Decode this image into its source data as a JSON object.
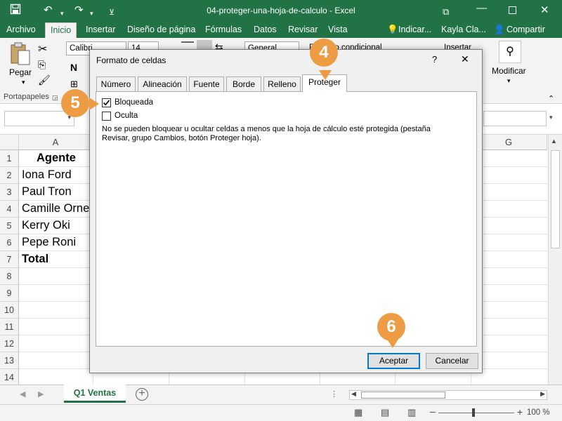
{
  "window": {
    "title": "04-proteger-una-hoja-de-calculo  -  Excel"
  },
  "menu": {
    "tabs": [
      "Archivo",
      "Inicio",
      "Insertar",
      "Diseño de página",
      "Fórmulas",
      "Datos",
      "Revisar",
      "Vista"
    ],
    "tell_me": "Indicar...",
    "user": "Kayla Cla...",
    "share": "Compartir"
  },
  "ribbon": {
    "paste_label": "Pegar",
    "clipboard_group": "Portapapeles",
    "font_name": "Calibri",
    "font_size": "14",
    "number_format": "General",
    "conditional_format": "Formato condicional",
    "insert_label": "Insertar",
    "modify_label": "Modificar"
  },
  "sheet": {
    "columns": [
      "A",
      "G"
    ],
    "rows": [
      "1",
      "2",
      "3",
      "4",
      "5",
      "6",
      "7",
      "8",
      "9",
      "10",
      "11",
      "12",
      "13",
      "14"
    ],
    "cells": [
      "Agente",
      "Iona Ford",
      "Paul Tron",
      "Camille  Orne",
      "Kerry Oki",
      "Pepe Roni",
      "Total"
    ],
    "active_tab": "Q1 Ventas",
    "zoom": "100 %"
  },
  "dialog": {
    "title": "Formato de celdas",
    "help": "?",
    "close": "✕",
    "tabs": [
      "Número",
      "Alineación",
      "Fuente",
      "Borde",
      "Relleno",
      "Proteger"
    ],
    "locked_label": "Bloqueada",
    "locked_checked": true,
    "hidden_label": "Oculta",
    "hidden_checked": false,
    "note": "No se pueden bloquear u ocultar celdas a menos que la hoja de cálculo esté protegida (pestaña Revisar, grupo Cambios, botón Proteger hoja).",
    "ok_button": "Aceptar",
    "cancel_button": "Cancelar"
  },
  "callouts": [
    "4",
    "5",
    "6"
  ],
  "colors": {
    "excel_green": "#217346",
    "callout": "#ed9c44",
    "default_button_border": "#0078d7"
  }
}
